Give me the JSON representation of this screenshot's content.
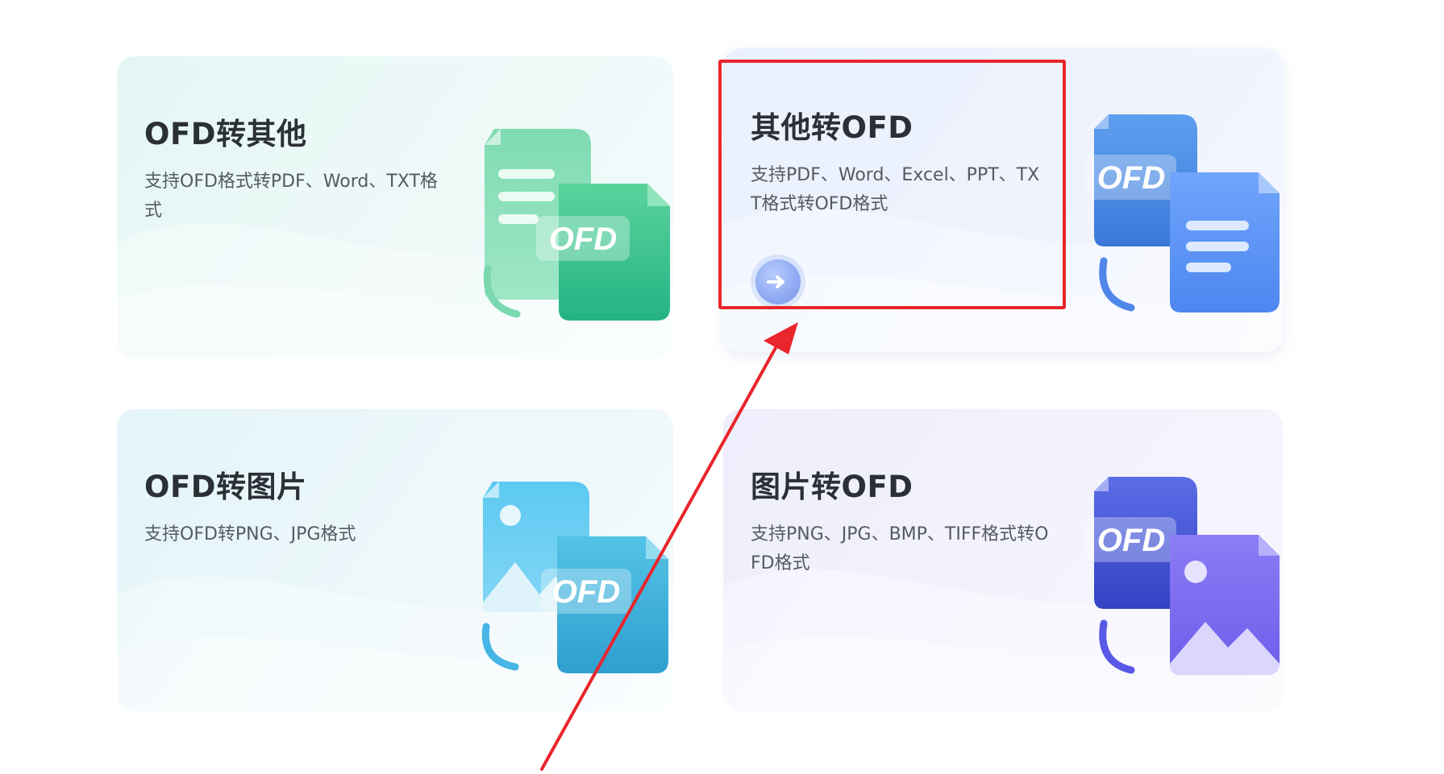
{
  "cards": [
    {
      "title": "OFD转其他",
      "desc": "支持OFD格式转PDF、Word、TXT格式",
      "badge": "OFD",
      "icon": "ofd-to-document-icon",
      "accent": "#2fc08a"
    },
    {
      "title": "其他转OFD",
      "desc": "支持PDF、Word、Excel、PPT、TXT格式转OFD格式",
      "badge": "OFD",
      "icon": "document-to-ofd-icon",
      "accent": "#3d7ff0",
      "button_icon": "arrow-right-icon"
    },
    {
      "title": "OFD转图片",
      "desc": "支持OFD转PNG、JPG格式",
      "badge": "OFD",
      "icon": "ofd-to-image-icon",
      "accent": "#2aa9dc"
    },
    {
      "title": "图片转OFD",
      "desc": "支持PNG、JPG、BMP、TIFF格式转OFD格式",
      "badge": "OFD",
      "icon": "image-to-ofd-icon",
      "accent": "#6a5cf0"
    }
  ],
  "annotation": {
    "color": "#e8262b",
    "target": "其他转OFD"
  }
}
